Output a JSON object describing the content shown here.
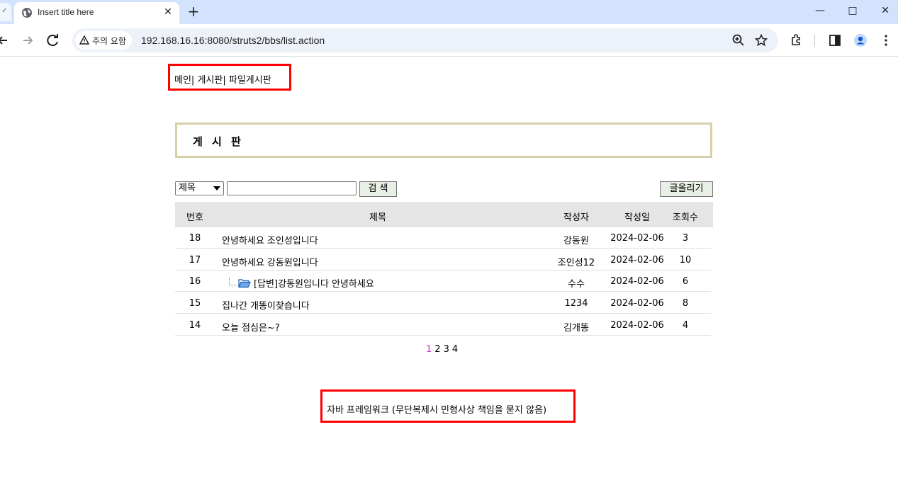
{
  "browser": {
    "tab_title": "Insert title here",
    "security_label": "주의 요함",
    "url": "192.168.16.16:8080/struts2/bbs/list.action"
  },
  "menu": {
    "items": [
      "메인",
      "게시판",
      "파일게시판"
    ],
    "separator": "|"
  },
  "board": {
    "title": "게 시 판"
  },
  "search": {
    "field_selected": "제목",
    "input_value": "",
    "search_button": "검 색",
    "write_button": "글올리기"
  },
  "table": {
    "headers": {
      "num": "번호",
      "subject": "제목",
      "writer": "작성자",
      "date": "작성일",
      "hits": "조회수"
    },
    "rows": [
      {
        "num": "18",
        "subject": "안녕하세요 조인성입니다",
        "writer": "강동원",
        "date": "2024-02-06",
        "hits": "3"
      },
      {
        "num": "17",
        "subject": "안녕하세요 강동원입니다",
        "writer": "조인성12",
        "date": "2024-02-06",
        "hits": "10"
      },
      {
        "num": "16",
        "subject": "[답변]강동원입니다 안녕하세요",
        "writer": "수수",
        "date": "2024-02-06",
        "hits": "6",
        "reply": true
      },
      {
        "num": "15",
        "subject": "집나간 개똥이찾습니다",
        "writer": "1234",
        "date": "2024-02-06",
        "hits": "8"
      },
      {
        "num": "14",
        "subject": "오늘 점심은~?",
        "writer": "김개똥",
        "date": "2024-02-06",
        "hits": "4"
      }
    ]
  },
  "pagination": {
    "current": "1",
    "pages": [
      "1",
      "2",
      "3",
      "4"
    ]
  },
  "footer": {
    "text": "자바 프레임워크 (무단복제시 민형사상 책임을 묻지 않음)"
  },
  "colors": {
    "highlight_border": "#ff0000",
    "title_border": "#d6cfa8",
    "current_page": "#cc33cc",
    "tabstrip": "#d3e3fd"
  }
}
